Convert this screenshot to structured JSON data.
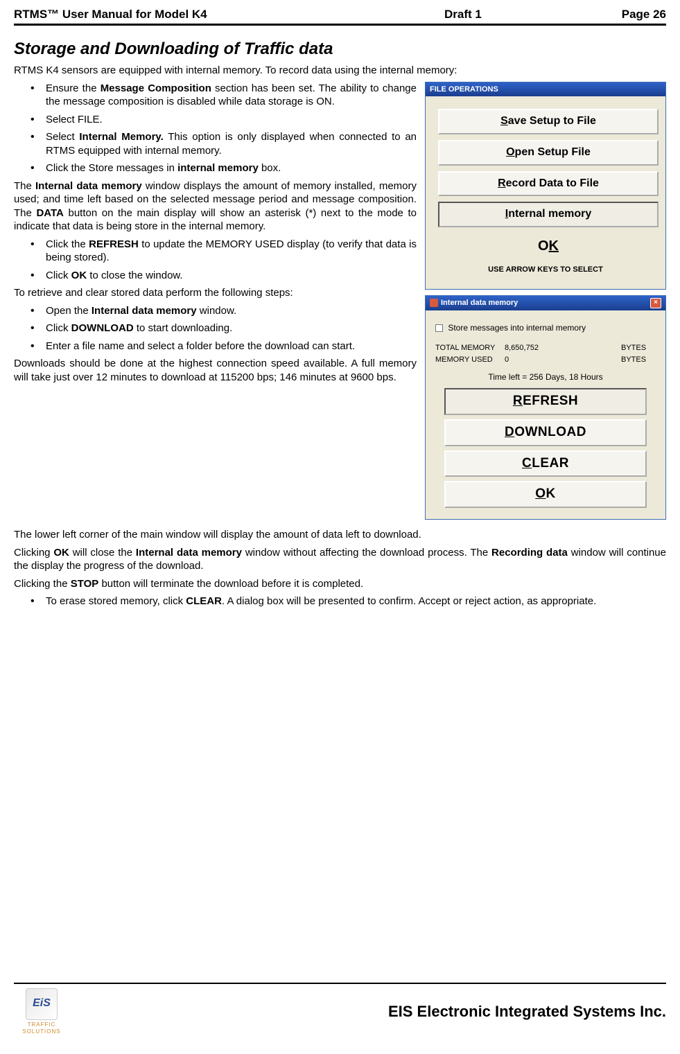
{
  "header": {
    "left": "RTMS™  User Manual for Model K4",
    "mid": "Draft 1",
    "right": "Page 26"
  },
  "title": "Storage and Downloading of Traffic data",
  "intro": "RTMS K4 sensors are equipped with internal memory. To record data using the internal memory:",
  "bullets1": [
    {
      "pre": "Ensure the ",
      "bold": "Message Composition",
      "post": " section has been set.  The ability to change the message composition is disabled while data storage is ON."
    },
    {
      "pre": "Select FILE.",
      "bold": "",
      "post": ""
    },
    {
      "pre": "Select ",
      "bold": "Internal Memory.",
      "post": " This option is only displayed when connected to an RTMS equipped with internal memory."
    },
    {
      "pre": "Click the Store messages in ",
      "bold": "internal memory",
      "post": " box."
    }
  ],
  "para1_a": "The ",
  "para1_b": "Internal data memory",
  "para1_c": " window displays the amount of memory installed, memory used; and time left based on the selected message period and message composition.  The ",
  "para1_d": "DATA",
  "para1_e": " button on the main display will show an asterisk (*) next to the mode to indicate that data is being store in the internal memory.",
  "bullets2": [
    {
      "pre": "Click the ",
      "bold": "REFRESH",
      "post": " to update the MEMORY USED display (to verify that data is being stored)."
    },
    {
      "pre": "Click ",
      "bold": "OK",
      "post": " to close the window."
    }
  ],
  "para2": "To retrieve and clear stored data perform the following steps:",
  "bullets3": [
    {
      "pre": "Open the ",
      "bold": "Internal data memory",
      "post": " window."
    },
    {
      "pre": "Click ",
      "bold": "DOWNLOAD",
      "post": " to start downloading."
    },
    {
      "pre": "Enter a file name and select a folder before the download can start.",
      "bold": "",
      "post": ""
    }
  ],
  "para3": "Downloads should be done at the highest connection speed available.  A full memory will take just over 12 minutes to download at 115200 bps; 146 minutes at 9600 bps.",
  "para4": "The lower left corner of the main window will display the amount of data left to download.",
  "para5_a": "Clicking ",
  "para5_b": "OK",
  "para5_c": " will close the ",
  "para5_d": "Internal data memory",
  "para5_e": " window without affecting the download process. The ",
  "para5_f": "Recording data",
  "para5_g": " window will continue the display the progress of the download.",
  "para6_a": "Clicking the ",
  "para6_b": "STOP",
  "para6_c": " button will terminate the download before it is completed.",
  "bullets4": [
    {
      "pre": "To erase stored memory, click ",
      "bold": "CLEAR",
      "post": ". A dialog box will be presented to confirm.  Accept or reject action, as appropriate."
    }
  ],
  "dlg1": {
    "title": "FILE OPERATIONS",
    "buttons": [
      "Save Setup to File",
      "Open Setup File",
      "Record Data to File",
      "Internal memory",
      "OK"
    ],
    "mnemonics": [
      "S",
      "O",
      "R",
      "I",
      "K"
    ],
    "footnote": "USE ARROW KEYS TO SELECT"
  },
  "dlg2": {
    "title": "Internal data memory",
    "checkbox": "Store messages into internal memory",
    "total_label": "TOTAL MEMORY",
    "total_value": "8,650,752",
    "used_label": "MEMORY USED",
    "used_value": "0",
    "bytes": "BYTES",
    "time_left": "Time left = 256 Days, 18 Hours",
    "buttons": [
      "REFRESH",
      "DOWNLOAD",
      "CLEAR",
      "OK"
    ],
    "mnemonics": [
      "R",
      "D",
      "C",
      "O"
    ]
  },
  "footer": {
    "logo_text": "EiS",
    "logo_sub": "TRAFFIC SOLUTIONS",
    "company": "EIS Electronic Integrated Systems Inc."
  }
}
